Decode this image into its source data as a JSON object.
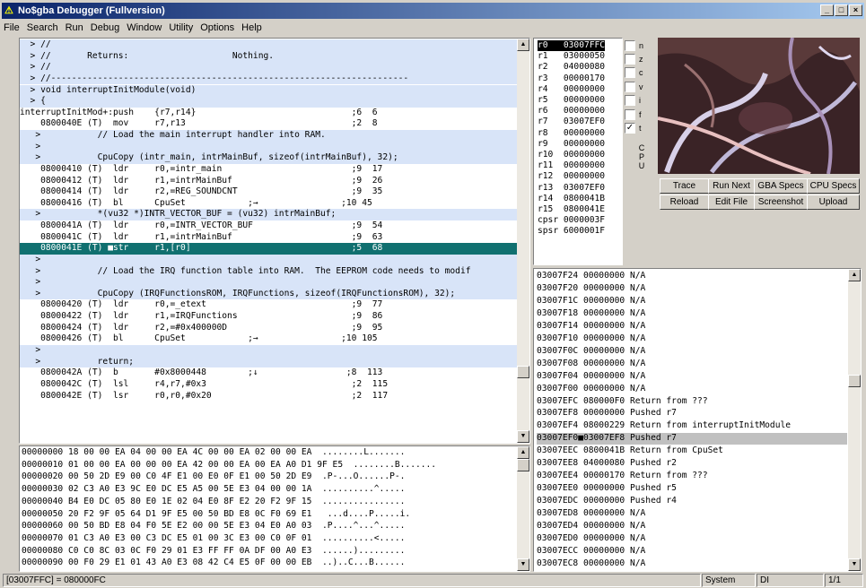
{
  "window": {
    "title": "No$gba Debugger (Fullversion)",
    "min": "_",
    "max": "□",
    "close": "×"
  },
  "menu": [
    "File",
    "Search",
    "Run",
    "Debug",
    "Window",
    "Utility",
    "Options",
    "Help"
  ],
  "disasm": [
    {
      "t": "  > //",
      "k": "cmt"
    },
    {
      "t": "  > //       Returns:                    Nothing.",
      "k": "cmt"
    },
    {
      "t": "  > //",
      "k": "cmt"
    },
    {
      "t": "  > //---------------------------------------------------------------------",
      "k": "cmt"
    },
    {
      "t": "  > void interruptInitModule(void)",
      "k": "cmt"
    },
    {
      "t": "  > {",
      "k": "cmt"
    },
    {
      "t": "interruptInitMod+:push    {r7,r14}                              ;6  6",
      "k": ""
    },
    {
      "t": "    0800040E (T)  mov     r7,r13                                ;2  8",
      "k": ""
    },
    {
      "t": "   >           // Load the main interrupt handler into RAM.",
      "k": "cmt"
    },
    {
      "t": "   >",
      "k": "cmt"
    },
    {
      "t": "   >           CpuCopy (intr_main, intrMainBuf, sizeof(intrMainBuf), 32);",
      "k": "cmt"
    },
    {
      "t": "    08000410 (T)  ldr     r0,=intr_main                         ;9  17",
      "k": ""
    },
    {
      "t": "    08000412 (T)  ldr     r1,=intrMainBuf                       ;9  26",
      "k": ""
    },
    {
      "t": "    08000414 (T)  ldr     r2,=REG_SOUNDCNT                      ;9  35",
      "k": ""
    },
    {
      "t": "    08000416 (T)  bl      CpuSet            ;→                ;10 45",
      "k": ""
    },
    {
      "t": "   >           *(vu32 *)INTR_VECTOR_BUF = (vu32) intrMainBuf;",
      "k": "cmt"
    },
    {
      "t": "    0800041A (T)  ldr     r0,=INTR_VECTOR_BUF                   ;9  54",
      "k": ""
    },
    {
      "t": "    0800041C (T)  ldr     r1,=intrMainBuf                       ;9  63",
      "k": ""
    },
    {
      "t": "    0800041E (T) ■str     r1,[r0]                               ;5  68",
      "k": "cur"
    },
    {
      "t": "   >",
      "k": "cmt"
    },
    {
      "t": "   >           // Load the IRQ function table into RAM.  The EEPROM code needs to modif",
      "k": "cmt"
    },
    {
      "t": "   >",
      "k": "cmt"
    },
    {
      "t": "   >           CpuCopy (IRQFunctionsROM, IRQFunctions, sizeof(IRQFunctionsROM), 32);",
      "k": "cmt"
    },
    {
      "t": "    08000420 (T)  ldr     r0,=_etext                            ;9  77",
      "k": ""
    },
    {
      "t": "    08000422 (T)  ldr     r1,=IRQFunctions                      ;9  86",
      "k": ""
    },
    {
      "t": "    08000424 (T)  ldr     r2,=#0x400000D                        ;9  95",
      "k": ""
    },
    {
      "t": "    08000426 (T)  bl      CpuSet            ;→                ;10 105",
      "k": ""
    },
    {
      "t": "   >",
      "k": "cmt"
    },
    {
      "t": "   >           return;",
      "k": "cmt"
    },
    {
      "t": "    0800042A (T)  b       #0x8000448        ;↓                 ;8  113",
      "k": ""
    },
    {
      "t": "    0800042C (T)  lsl     r4,r7,#0x3                            ;2  115",
      "k": ""
    },
    {
      "t": "    0800042E (T)  lsr     r0,r0,#0x20                           ;2  117",
      "k": ""
    }
  ],
  "registers": [
    {
      "t": "r0   03007FFC",
      "sel": true
    },
    {
      "t": "r1   03000050"
    },
    {
      "t": "r2   04000080"
    },
    {
      "t": "r3   00000170"
    },
    {
      "t": "r4   00000000"
    },
    {
      "t": "r5   00000000"
    },
    {
      "t": "r6   00000000"
    },
    {
      "t": "r7   03007EF0"
    },
    {
      "t": "r8   00000000"
    },
    {
      "t": "r9   00000000"
    },
    {
      "t": "r10  00000000"
    },
    {
      "t": "r11  00000000"
    },
    {
      "t": "r12  00000000"
    },
    {
      "t": "r13  03007EF0"
    },
    {
      "t": "r14  0800041B"
    },
    {
      "t": "r15  0800041E"
    },
    {
      "t": "cpsr 0000003F"
    },
    {
      "t": "spsr 6000001F"
    }
  ],
  "flags": [
    {
      "l": "n",
      "c": ""
    },
    {
      "l": "z",
      "c": ""
    },
    {
      "l": "c",
      "c": ""
    },
    {
      "l": "v",
      "c": ""
    },
    {
      "l": "i",
      "c": ""
    },
    {
      "l": "f",
      "c": ""
    },
    {
      "l": "t",
      "c": "✓"
    }
  ],
  "cpu_label": "CPU",
  "buttons": [
    "Trace",
    "Run Next",
    "GBA Specs",
    "CPU Specs",
    "Reload",
    "Edit File",
    "Screenshot",
    "Upload"
  ],
  "stack": [
    {
      "t": "03007F24 00000000 N/A"
    },
    {
      "t": "03007F20 00000000 N/A"
    },
    {
      "t": "03007F1C 00000000 N/A"
    },
    {
      "t": "03007F18 00000000 N/A"
    },
    {
      "t": "03007F14 00000000 N/A"
    },
    {
      "t": "03007F10 00000000 N/A"
    },
    {
      "t": "03007F0C 00000000 N/A"
    },
    {
      "t": "03007F08 00000000 N/A"
    },
    {
      "t": "03007F04 00000000 N/A"
    },
    {
      "t": "03007F00 00000000 N/A"
    },
    {
      "t": "03007EFC 080000F0 Return from ???"
    },
    {
      "t": "03007EF8 00000000 Pushed r7"
    },
    {
      "t": "03007EF4 08000229 Return from interruptInitModule"
    },
    {
      "t": "03007EF0■03007EF8 Pushed r7",
      "sel": true
    },
    {
      "t": "03007EEC 0800041B Return from CpuSet"
    },
    {
      "t": "03007EE8 04000080 Pushed r2"
    },
    {
      "t": "03007EE4 00000170 Return from ???"
    },
    {
      "t": "03007EE0 00000000 Pushed r5"
    },
    {
      "t": "03007EDC 00000000 Pushed r4"
    },
    {
      "t": "03007ED8 00000000 N/A"
    },
    {
      "t": "03007ED4 00000000 N/A"
    },
    {
      "t": "03007ED0 00000000 N/A"
    },
    {
      "t": "03007ECC 00000000 N/A"
    },
    {
      "t": "03007EC8 00000000 N/A"
    }
  ],
  "hexdump": [
    "00000000 18 00 00 EA 04 00 00 EA 4C 00 00 EA 02 00 00 EA  ........L.......",
    "00000010 01 00 00 EA 00 00 00 EA 42 00 00 EA 00 EA A0 D1 9F E5  ........B.......",
    "00000020 00 50 2D E9 00 C0 4F E1 00 E0 0F E1 00 50 2D E9  .P-...O......P-.",
    "00000030 02 C3 A0 E3 9C E0 DC E5 A5 00 5E E3 04 00 00 1A  ..........^.....",
    "00000040 B4 E0 DC 05 80 E0 1E 02 04 E0 8F E2 20 F2 9F 15  ................",
    "00000050 20 F2 9F 05 64 D1 9F E5 00 50 BD E8 0C F0 69 E1   ...d....P.....i.",
    "00000060 00 50 BD E8 04 F0 5E E2 00 00 5E E3 04 E0 A0 03  .P....^...^.....",
    "00000070 01 C3 A0 E3 00 C3 DC E5 01 00 3C E3 00 C0 0F 01  ..........<.....",
    "00000080 C0 C0 8C 03 0C F0 29 01 E3 FF FF 0A DF 00 A0 E3  ......).........",
    "00000090 00 F0 29 E1 01 43 A0 E3 08 42 C4 E5 0F 00 00 EB  ..)..C...B......"
  ],
  "status": {
    "left": "[03007FFC] = 080000FC",
    "mode": "System",
    "di": "DI",
    "page": "1/1"
  }
}
